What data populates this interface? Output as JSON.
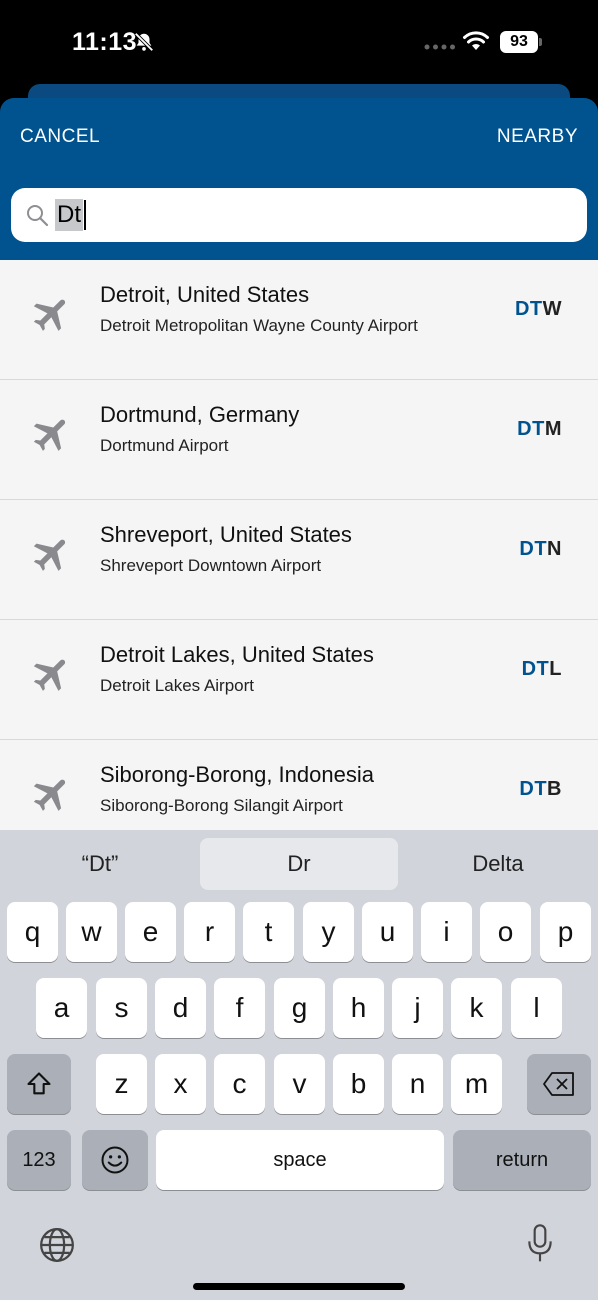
{
  "status": {
    "time": "11:13",
    "battery": "93"
  },
  "header": {
    "cancel_label": "CANCEL",
    "nearby_label": "NEARBY"
  },
  "search": {
    "value": "Dt"
  },
  "results": [
    {
      "city": "Detroit, United States",
      "airport": "Detroit Metropolitan Wayne County Airport",
      "code_match": "DT",
      "code_rest": "W"
    },
    {
      "city": "Dortmund, Germany",
      "airport": "Dortmund Airport",
      "code_match": "DT",
      "code_rest": "M"
    },
    {
      "city": "Shreveport, United States",
      "airport": "Shreveport Downtown Airport",
      "code_match": "DT",
      "code_rest": "N"
    },
    {
      "city": "Detroit Lakes, United States",
      "airport": "Detroit Lakes Airport",
      "code_match": "DT",
      "code_rest": "L"
    },
    {
      "city": "Siborong-Borong, Indonesia",
      "airport": "Siborong-Borong Silangit Airport",
      "code_match": "DT",
      "code_rest": "B"
    }
  ],
  "keyboard": {
    "suggestions": [
      "“Dt”",
      "Dr",
      "Delta"
    ],
    "row1": [
      "q",
      "w",
      "e",
      "r",
      "t",
      "y",
      "u",
      "i",
      "o",
      "p"
    ],
    "row2": [
      "a",
      "s",
      "d",
      "f",
      "g",
      "h",
      "j",
      "k",
      "l"
    ],
    "row3": [
      "z",
      "x",
      "c",
      "v",
      "b",
      "n",
      "m"
    ],
    "numbers_label": "123",
    "space_label": "space",
    "return_label": "return"
  },
  "colors": {
    "brand": "#00538f",
    "keyboard_bg": "#d1d4da"
  },
  "icons": [
    "bell-slash-icon",
    "wifi-icon",
    "battery-icon",
    "search-icon",
    "airplane-icon",
    "shift-icon",
    "delete-icon",
    "emoji-icon",
    "globe-icon",
    "microphone-icon"
  ]
}
